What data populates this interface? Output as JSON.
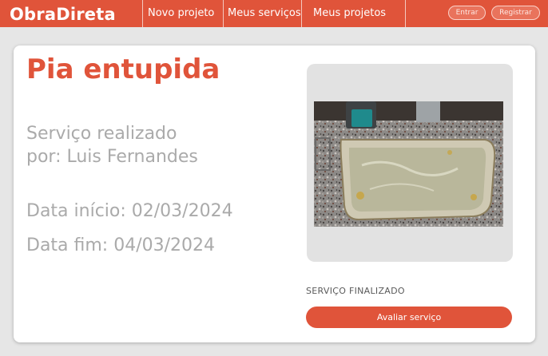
{
  "brand": "ObraDireta",
  "nav": {
    "new_project": "Novo projeto",
    "my_services": "Meus serviços",
    "my_projects": "Meus projetos"
  },
  "auth": {
    "login": "Entrar",
    "register": "Registrar"
  },
  "service": {
    "title": "Pia entupida",
    "performed_by_line1": "Serviço realizado",
    "performed_by_line2": "por: Luis Fernandes",
    "start_date": "Data início: 02/03/2024",
    "end_date": "Data fim: 04/03/2024",
    "status": "SERVIÇO FINALIZADO",
    "rate_button": "Avaliar serviço"
  },
  "colors": {
    "accent": "#e0543a",
    "page_bg": "#e6e6e6",
    "muted_text": "#aaaaaa"
  }
}
